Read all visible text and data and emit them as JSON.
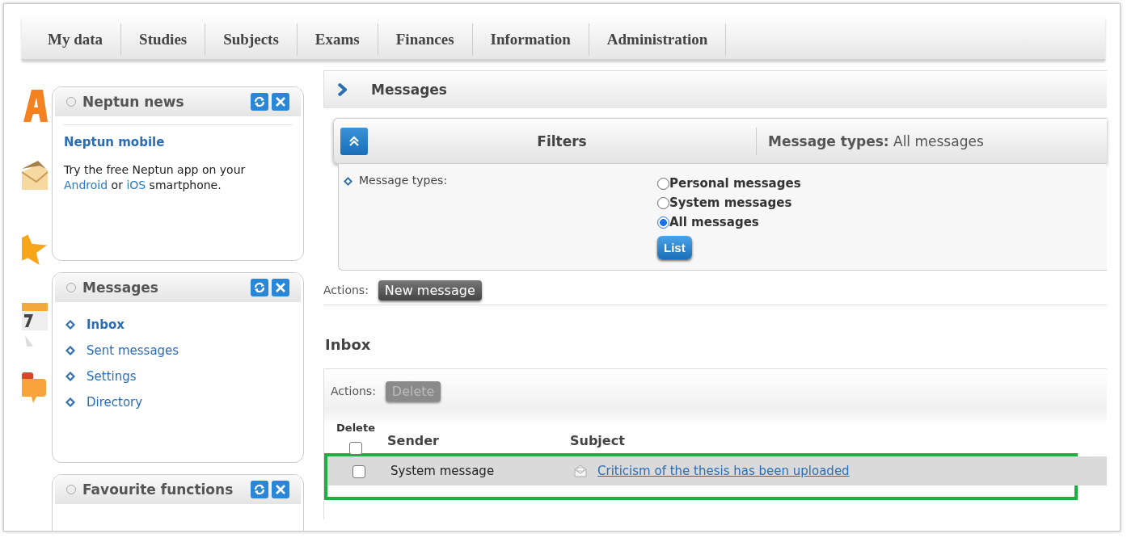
{
  "menu": [
    {
      "label": "My data"
    },
    {
      "label": "Studies"
    },
    {
      "label": "Subjects"
    },
    {
      "label": "Exams"
    },
    {
      "label": "Finances"
    },
    {
      "label": "Information"
    },
    {
      "label": "Administration"
    }
  ],
  "sidebar": {
    "panels": [
      {
        "title": "Neptun news",
        "kind": "news",
        "heading": "Neptun mobile",
        "text": [
          {
            "text": "Try the free Neptun app on your "
          },
          {
            "text": "Android",
            "link": true
          },
          {
            "text": " or "
          },
          {
            "text": "iOS",
            "link": true
          },
          {
            "text": " smartphone."
          }
        ]
      },
      {
        "title": "Messages",
        "kind": "links",
        "items": [
          {
            "label": "Inbox",
            "selected": true
          },
          {
            "label": "Sent messages",
            "selected": false
          },
          {
            "label": "Settings",
            "selected": false
          },
          {
            "label": "Directory",
            "selected": false
          }
        ]
      },
      {
        "title": "Favourite functions",
        "kind": "empty"
      }
    ]
  },
  "main": {
    "title": "Messages",
    "filters": {
      "title": "Filters",
      "expanded": true,
      "summary_label": "Message types:",
      "summary_value": "All messages",
      "field_label": "Message types:",
      "options": [
        {
          "label": "Personal messages",
          "selected": false
        },
        {
          "label": "System messages",
          "selected": false
        },
        {
          "label": "All messages",
          "selected": true
        }
      ],
      "button": "List"
    },
    "actions": {
      "label": "Actions:",
      "button": "New message"
    },
    "inbox": {
      "title": "Inbox",
      "actions_label": "Actions:",
      "delete_button": {
        "label": "Delete",
        "disabled": true
      },
      "columns": [
        "Delete",
        "Sender",
        "Subject"
      ],
      "select_all": {
        "checked": false
      },
      "rows": [
        {
          "checked": false,
          "sender": "System message",
          "subject": "Criticism of the thesis has been uploaded",
          "highlighted": true
        }
      ]
    }
  }
}
